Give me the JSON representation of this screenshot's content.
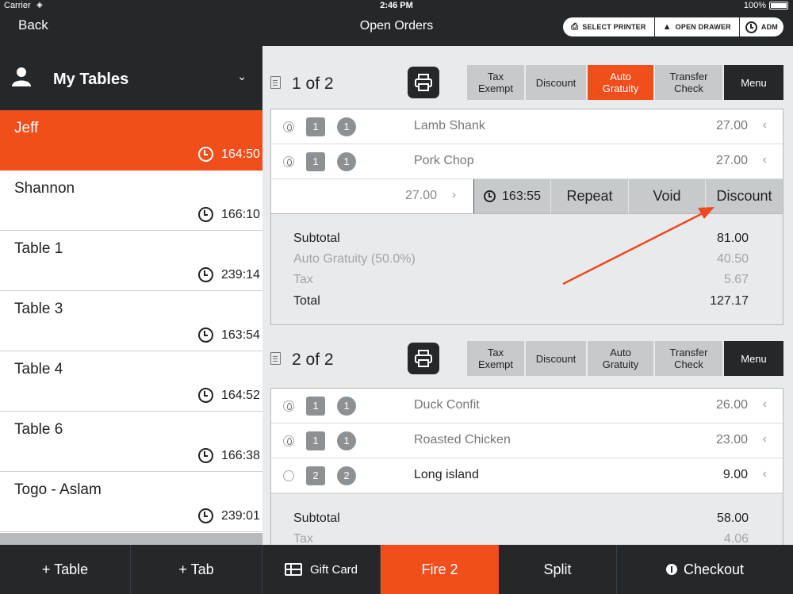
{
  "status_bar": {
    "carrier": "Carrier",
    "time": "2:46 PM",
    "battery": "100%"
  },
  "nav": {
    "back": "Back",
    "title": "Open Orders",
    "pills": [
      "SELECT PRINTER",
      "OPEN DRAWER",
      "ADM"
    ]
  },
  "sidebar": {
    "title": "My Tables",
    "tables": [
      {
        "name": "Jeff",
        "time": "164:50"
      },
      {
        "name": "Shannon",
        "time": "166:10"
      },
      {
        "name": "Table 1",
        "time": "239:14"
      },
      {
        "name": "Table 3",
        "time": "163:54"
      },
      {
        "name": "Table 4",
        "time": "164:52"
      },
      {
        "name": "Table 6",
        "time": "166:38"
      },
      {
        "name": "Togo - Aslam",
        "time": "239:01"
      }
    ]
  },
  "checks": [
    {
      "number": "1 of 2",
      "actions": [
        "Tax Exempt",
        "Discount",
        "Auto Gratuity",
        "Transfer Check",
        "Menu"
      ],
      "items": [
        {
          "seat": "1",
          "qty": "1",
          "name": "Lamb Shank",
          "price": "27.00"
        },
        {
          "seat": "1",
          "qty": "1",
          "name": "Pork Chop",
          "price": "27.00"
        }
      ],
      "expanded": {
        "price": "27.00",
        "time": "163:55",
        "buttons": [
          "Repeat",
          "Void",
          "Discount"
        ]
      },
      "totals": [
        {
          "label": "Subtotal",
          "value": "81.00"
        },
        {
          "label": "Auto Gratuity (50.0%)",
          "value": "40.50"
        },
        {
          "label": "Tax",
          "value": "5.67"
        },
        {
          "label": "Total",
          "value": "127.17"
        }
      ]
    },
    {
      "number": "2 of 2",
      "actions": [
        "Tax Exempt",
        "Discount",
        "Auto Gratuity",
        "Transfer Check",
        "Menu"
      ],
      "items": [
        {
          "seat": "1",
          "qty": "1",
          "name": "Duck Confit",
          "price": "26.00"
        },
        {
          "seat": "1",
          "qty": "1",
          "name": "Roasted Chicken",
          "price": "23.00"
        },
        {
          "seat": "2",
          "qty": "2",
          "name": "Long island",
          "price": "9.00"
        }
      ],
      "totals": [
        {
          "label": "Subtotal",
          "value": "58.00"
        },
        {
          "label": "Tax",
          "value": "4.06"
        }
      ]
    }
  ],
  "bottom_bar": {
    "add_table": "+ Table",
    "add_tab": "+ Tab",
    "gift_card": "Gift Card",
    "fire": "Fire 2",
    "split": "Split",
    "checkout": "Checkout"
  },
  "colors": {
    "accent": "#f04e1b",
    "dark": "#24282b",
    "button_gray": "#c7cacd"
  }
}
